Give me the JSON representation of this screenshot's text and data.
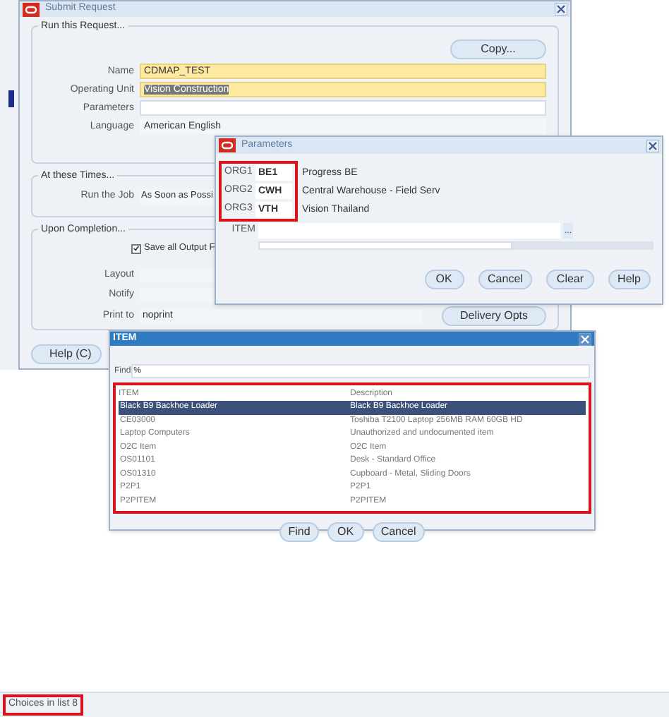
{
  "submit_window": {
    "title": "Submit Request",
    "run_group": "Run this Request...",
    "copy_button": "Copy...",
    "fields": [
      {
        "label": "Name",
        "value": "CDMAP_TEST",
        "kind": "required"
      },
      {
        "label": "Operating Unit",
        "value": "Vision Construction",
        "kind": "selected"
      },
      {
        "label": "Parameters",
        "kind": "plain"
      },
      {
        "label": "Language",
        "value": "American English",
        "kind": "readonly"
      }
    ],
    "times_group": "At these Times...",
    "run_job_label": "Run the Job",
    "run_job_value": "As Soon as Possi",
    "completion_group": "Upon Completion...",
    "save_output": {
      "label": "Save all Output F",
      "checked": true
    },
    "completion_fields": [
      {
        "label": "Layout"
      },
      {
        "label": "Notify"
      },
      {
        "label": "Print to",
        "value": "noprint"
      }
    ],
    "delivery_button": "Delivery Opts",
    "help_button": "Help (C)"
  },
  "parameters_window": {
    "title": "Parameters",
    "orgs": [
      {
        "label": "ORG1",
        "code": "BE1",
        "name": "Progress BE"
      },
      {
        "label": "ORG2",
        "code": "CWH",
        "name": "Central Warehouse - Field Serv"
      },
      {
        "label": "ORG3",
        "code": "VTH",
        "name": "Vision Thailand"
      }
    ],
    "item_label": "ITEM",
    "lov_button": "...",
    "buttons": [
      "OK",
      "Cancel",
      "Clear",
      "Help"
    ]
  },
  "item_window": {
    "title": "ITEM",
    "find_label": "Find",
    "find_value": "%",
    "columns": [
      "ITEM",
      "Description"
    ],
    "rows": [
      {
        "item": "Black B9 Backhoe Loader",
        "description": "Black B9 Backhoe Loader",
        "selected": true
      },
      {
        "item": "CE03000",
        "description": "Toshiba T2100 Laptop 256MB RAM 60GB HD",
        "selected": false
      },
      {
        "item": "Laptop Computers",
        "description": "Unauthorized and undocumented item",
        "selected": false
      },
      {
        "item": "O2C Item",
        "description": "O2C Item",
        "selected": false
      },
      {
        "item": "OS01101",
        "description": "Desk - Standard Office",
        "selected": false
      },
      {
        "item": "OS01310",
        "description": "Cupboard - Metal, Sliding Doors",
        "selected": false
      },
      {
        "item": "P2P1",
        "description": "P2P1",
        "selected": false
      },
      {
        "item": "P2PITEM",
        "description": "P2PITEM",
        "selected": false
      }
    ],
    "buttons": [
      "Find",
      "OK",
      "Cancel"
    ]
  },
  "status_bar": {
    "text": "Choices in list 8"
  }
}
